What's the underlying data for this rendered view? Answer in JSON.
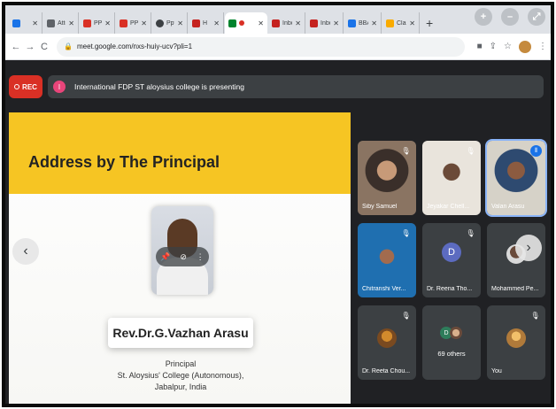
{
  "browser": {
    "tabs": [
      {
        "label": "",
        "fav_color": "#1a73e8",
        "active": false
      },
      {
        "label": "Atten",
        "fav_color": "#5f6368",
        "active": false
      },
      {
        "label": "PPT",
        "fav_color": "#d93025",
        "active": false
      },
      {
        "label": "PPT",
        "fav_color": "#d93025",
        "active": false
      },
      {
        "label": "Ppt",
        "fav_color": "#3c4043",
        "active": false
      },
      {
        "label": "H",
        "fav_color": "#c5221f",
        "active": false
      },
      {
        "label": "",
        "fav_color": "#00832d",
        "active": true
      },
      {
        "label": "Inbo",
        "fav_color": "#c5221f",
        "active": false
      },
      {
        "label": "Inbo",
        "fav_color": "#c5221f",
        "active": false
      },
      {
        "label": "BBA",
        "fav_color": "#1a73e8",
        "active": false
      },
      {
        "label": "Clas",
        "fav_color": "#f9ab00",
        "active": false
      }
    ],
    "new_tab_label": "+",
    "url": "meet.google.com/nxs-huiy-ucv?pli=1"
  },
  "meet": {
    "rec_label": "REC",
    "presenting_text": "International FDP ST aloysius college is presenting",
    "slide": {
      "title": "Address by The Principal",
      "speaker_name": "Rev.Dr.G.Vazhan Arasu",
      "designation_lines": [
        "Principal",
        "St. Aloysius' College (Autonomous),",
        "Jabalpur, India"
      ]
    },
    "participants": [
      {
        "name": "Siby Samuel",
        "type": "video",
        "muted": true
      },
      {
        "name": "Jeyakar Chell...",
        "type": "video",
        "muted": true
      },
      {
        "name": "Valan Arasu",
        "type": "video",
        "speaking": true
      },
      {
        "name": "Chitranshi Ver...",
        "type": "video",
        "muted": true
      },
      {
        "name": "Dr. Reena Tho...",
        "type": "avatar",
        "initial": "D",
        "muted": true
      },
      {
        "name": "Mohammed Pe...",
        "type": "avatar-photo",
        "muted": false
      },
      {
        "name": "Dr. Reeta Chou...",
        "type": "avatar-photo",
        "muted": true
      },
      {
        "name": "69 others",
        "type": "others",
        "initial": "D"
      },
      {
        "name": "You",
        "type": "avatar-photo",
        "muted": true
      }
    ]
  },
  "colors": {
    "accent_yellow": "#f6c523",
    "rec_red": "#d93025",
    "meet_bg": "#202124",
    "tile_bg": "#3c4043"
  }
}
